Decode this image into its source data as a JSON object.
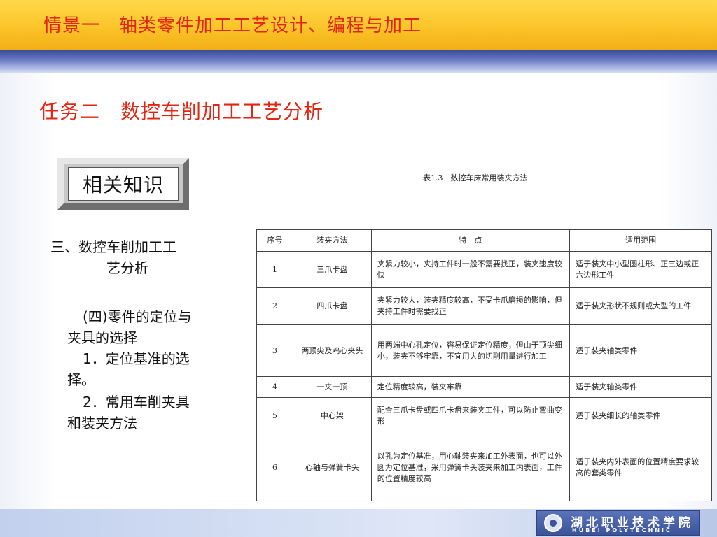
{
  "header": {
    "title": "情景一　轴类零件加工工艺设计、编程与加工"
  },
  "subtitle": "任务二　数控车削加工工艺分析",
  "knowledge_box": {
    "label": "相关知识"
  },
  "left_text": {
    "heading_line1": "三、数控车削加工工",
    "heading_line2": "艺分析",
    "point_line1": "(四)零件的定位与",
    "point_line2": "夹具的选择",
    "item1_line1": "1．定位基准的选",
    "item1_line2": "择。",
    "item2_line1": "2．常用车削夹具",
    "item2_line2": "和装夹方法"
  },
  "table": {
    "caption": "表1.3　数控车床常用装夹方法",
    "headers": [
      "序号",
      "装夹方法",
      "特　点",
      "适用范围"
    ],
    "rows": [
      [
        "1",
        "三爪卡盘",
        "夹紧力较小，夹持工件时一般不需要找正，装夹速度较快",
        "适于装夹中小型圆柱形、正三边或正六边形工件"
      ],
      [
        "2",
        "四爪卡盘",
        "夹紧力较大，装夹精度较高，不受卡爪磨损的影响，但夹持工件时需要找正",
        "适于装夹形状不规则或大型的工件"
      ],
      [
        "3",
        "两顶尖及鸡心夹头",
        "用两端中心孔定位，容易保证定位精度，但由于顶尖细小，装夹不够牢靠，不宜用大的切削用量进行加工",
        "适于装夹轴类零件"
      ],
      [
        "4",
        "一夹一顶",
        "定位精度较高，装夹牢靠",
        "适于装夹轴类零件"
      ],
      [
        "5",
        "中心架",
        "配合三爪卡盘或四爪卡盘来装夹工件，可以防止弯曲变形",
        "适于装夹细长的轴类零件"
      ],
      [
        "6",
        "心轴与弹簧卡头",
        "以孔为定位基准，用心轴装夹来加工外表面，也可以外圆为定位基准，采用弹簧卡头装夹来加工内表面，工件的位置精度较高",
        "适于装夹内外表面的位置精度要求较高的套类零件"
      ]
    ]
  },
  "footer": {
    "logo_cn": "湖北职业技术学院",
    "logo_en": "HUBEI POLYTECHNIC"
  }
}
